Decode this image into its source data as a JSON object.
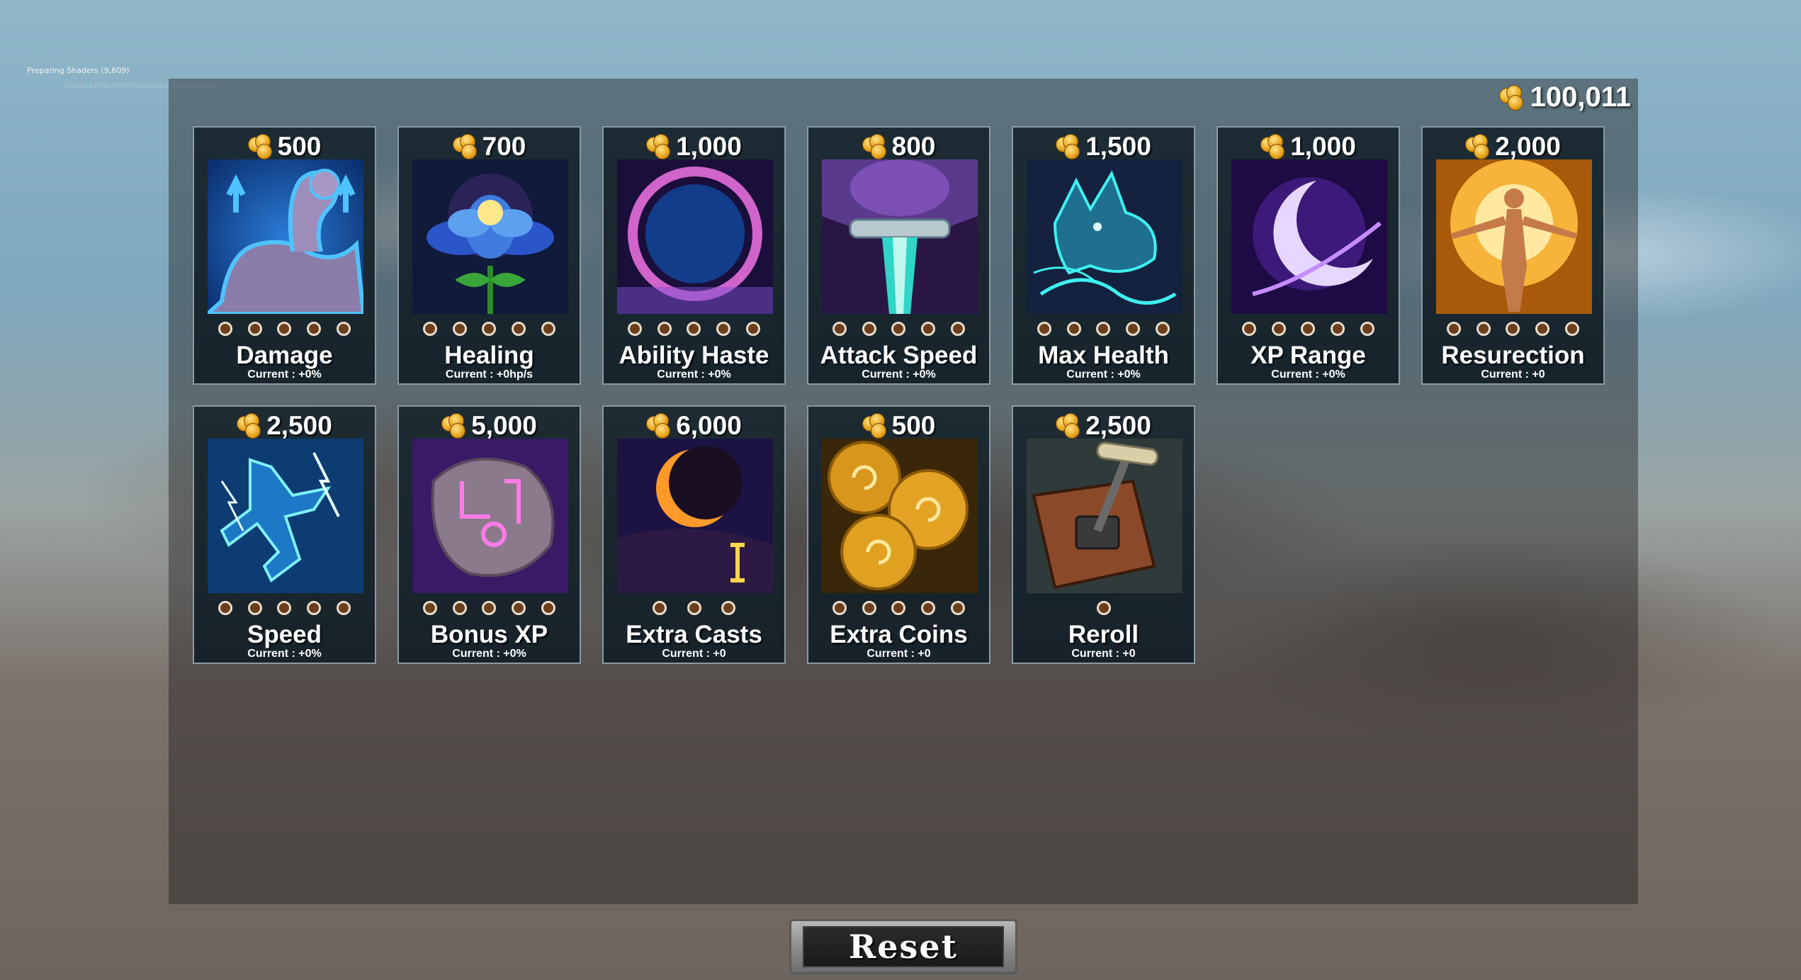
{
  "debug": {
    "line1": "Preparing Shaders (9,609)",
    "line2": "'DisableAllScreenMessages' to suppress"
  },
  "balance": "100,011",
  "upgrades_row1": [
    {
      "id": "damage",
      "price": "500",
      "name": "Damage",
      "current": "Current : +0%",
      "pips": 5,
      "icon": "flexed-arm-icon"
    },
    {
      "id": "healing",
      "price": "700",
      "name": "Healing",
      "current": "Current : +0hp/s",
      "pips": 5,
      "icon": "glowing-flower-icon"
    },
    {
      "id": "ability-haste",
      "price": "1,000",
      "name": "Ability Haste",
      "current": "Current : +0%",
      "pips": 5,
      "icon": "crescent-portal-icon"
    },
    {
      "id": "attack-speed",
      "price": "800",
      "name": "Attack Speed",
      "current": "Current : +0%",
      "pips": 5,
      "icon": "sword-hilt-icon"
    },
    {
      "id": "max-health",
      "price": "1,500",
      "name": "Max Health",
      "current": "Current : +0%",
      "pips": 5,
      "icon": "spirit-wolf-icon"
    },
    {
      "id": "xp-range",
      "price": "1,000",
      "name": "XP Range",
      "current": "Current : +0%",
      "pips": 5,
      "icon": "crescent-swirl-icon"
    },
    {
      "id": "resurrection",
      "price": "2,000",
      "name": "Resurection",
      "current": "Current : +0",
      "pips": 5,
      "icon": "rising-figure-icon"
    }
  ],
  "upgrades_row2": [
    {
      "id": "speed",
      "price": "2,500",
      "name": "Speed",
      "current": "Current : +0%",
      "pips": 5,
      "icon": "lightning-runner-icon"
    },
    {
      "id": "bonus-xp",
      "price": "5,000",
      "name": "Bonus XP",
      "current": "Current : +0%",
      "pips": 5,
      "icon": "rune-stone-icon"
    },
    {
      "id": "extra-casts",
      "price": "6,000",
      "name": "Extra Casts",
      "current": "Current : +0",
      "pips": 3,
      "icon": "eclipse-icon"
    },
    {
      "id": "extra-coins",
      "price": "500",
      "name": "Extra Coins",
      "current": "Current : +0",
      "pips": 5,
      "icon": "gold-coins-icon"
    },
    {
      "id": "reroll",
      "price": "2,500",
      "name": "Reroll",
      "current": "Current : +0",
      "pips": 1,
      "icon": "lever-icon"
    }
  ],
  "reset_label": "Reset"
}
